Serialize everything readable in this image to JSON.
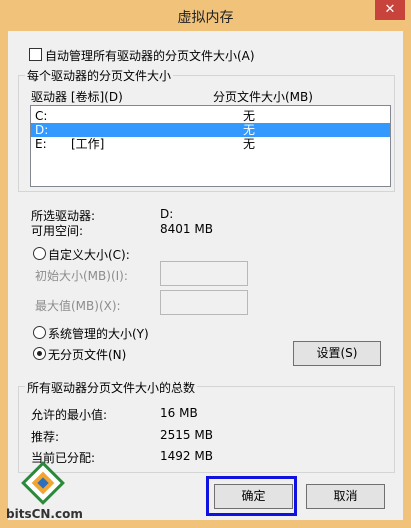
{
  "dialog": {
    "title": "虚拟内存"
  },
  "auto_manage": {
    "label": "自动管理所有驱动器的分页文件大小(A)",
    "checked": false
  },
  "per_drive": {
    "group_label": "每个驱动器的分页文件大小",
    "col_drive": "驱动器 [卷标](D)",
    "col_size": "分页文件大小(MB)",
    "rows": [
      {
        "drive": "C:",
        "label": "",
        "size": "无"
      },
      {
        "drive": "D:",
        "label": "",
        "size": "无",
        "selected": true
      },
      {
        "drive": "E:",
        "label": "[工作]",
        "size": "无"
      }
    ]
  },
  "selected_info": {
    "drive_label": "所选驱动器:",
    "drive_value": "D:",
    "space_label": "可用空间:",
    "space_value": "8401 MB"
  },
  "options": {
    "custom_label": "自定义大小(C):",
    "initial_label": "初始大小(MB)(I):",
    "max_label": "最大值(MB)(X):",
    "system_label": "系统管理的大小(Y)",
    "none_label": "无分页文件(N)",
    "selected": "none",
    "set_button": "设置(S)"
  },
  "totals": {
    "group_label": "所有驱动器分页文件大小的总数",
    "min_label": "允许的最小值:",
    "min_value": "16 MB",
    "rec_label": "推荐:",
    "rec_value": "2515 MB",
    "cur_label": "当前已分配:",
    "cur_value": "1492 MB"
  },
  "buttons": {
    "ok": "确定",
    "cancel": "取消"
  },
  "watermark": {
    "text": "bitsCN.com"
  },
  "colors": {
    "frame": "#f0c27a",
    "selection": "#3399ff",
    "highlight_box": "#1010e0",
    "close": "#c7433b"
  }
}
